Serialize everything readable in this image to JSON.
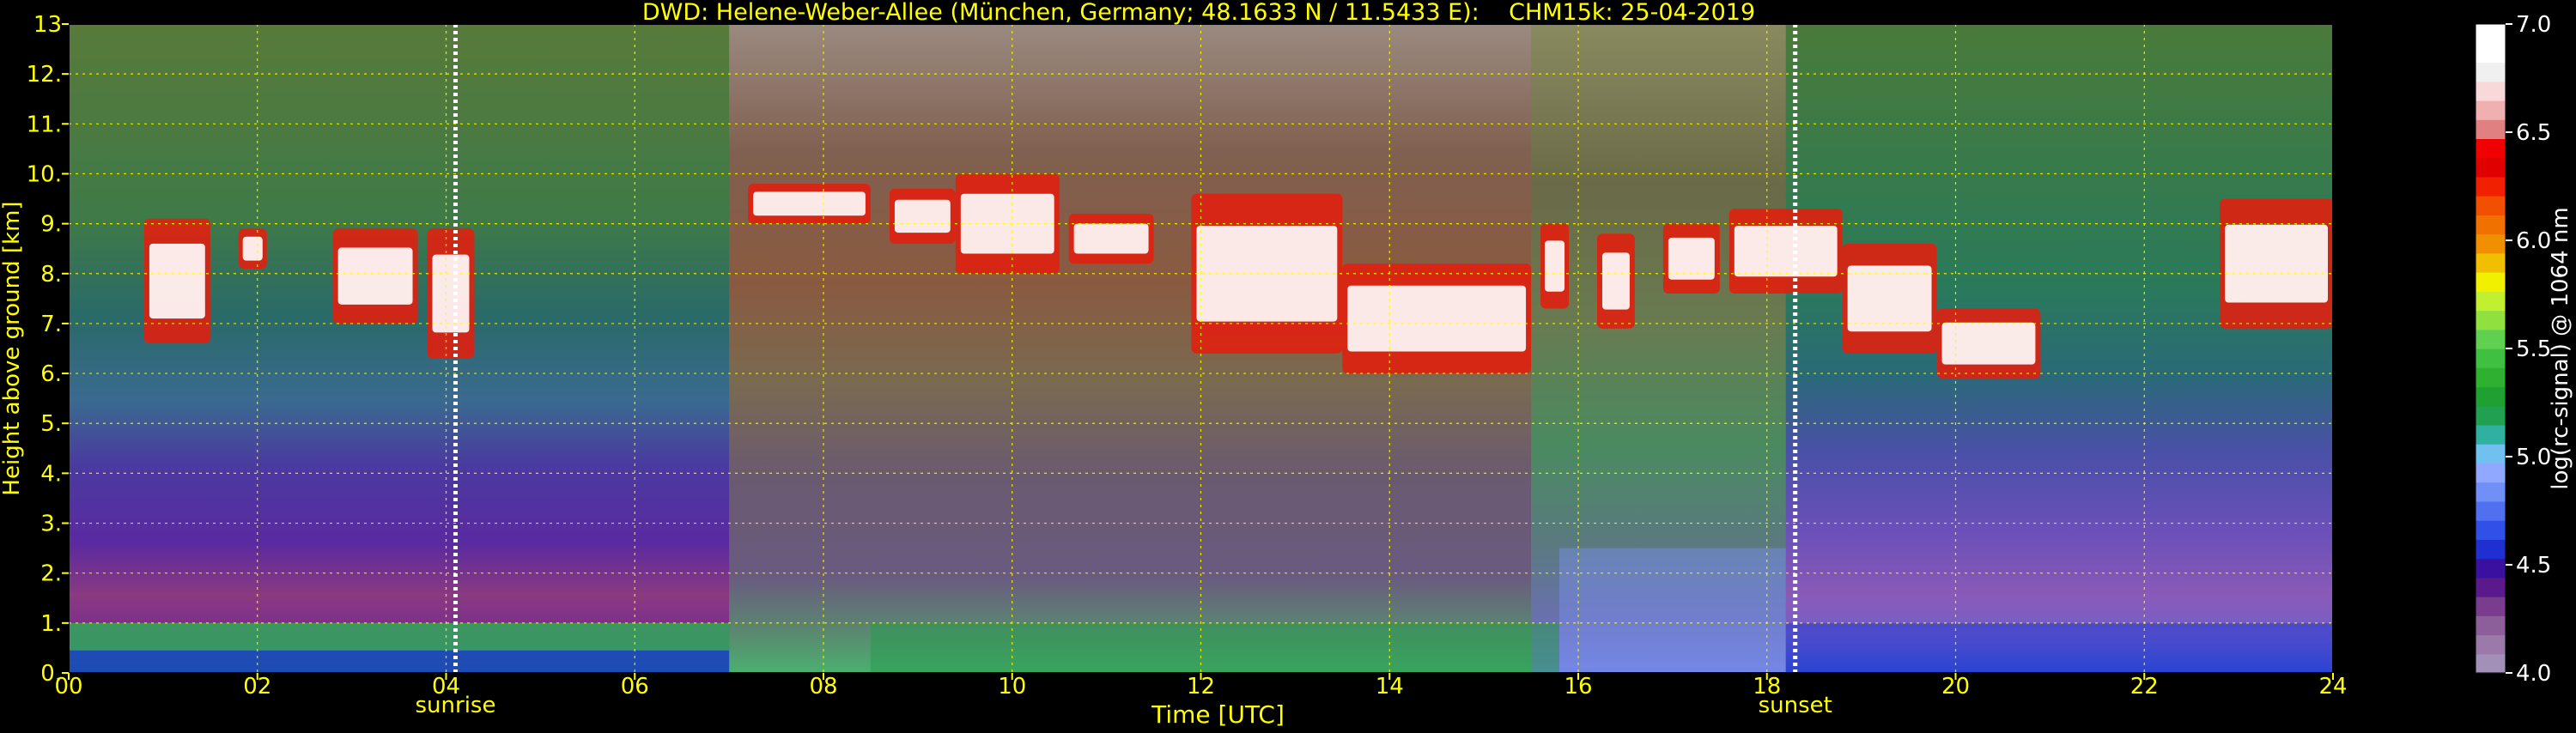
{
  "colors": {
    "background": "#000000",
    "axis_text": "#ffff00",
    "colorbar_text": "#ffffff",
    "grid": "#ffff00",
    "marker_line": "#ffffff"
  },
  "chart_data": {
    "type": "heatmap",
    "title": "DWD: Helene-Weber-Allee (München, Germany; 48.1633 N / 11.5433 E):    CHM15k: 25-04-2019",
    "xlabel": "Time [UTC]",
    "ylabel": "Height above ground [km]",
    "xlim": [
      0,
      24
    ],
    "ylim": [
      0,
      13
    ],
    "x_ticks": [
      0,
      2,
      4,
      6,
      8,
      10,
      12,
      14,
      16,
      18,
      20,
      22,
      24
    ],
    "x_tick_labels": [
      "00",
      "02",
      "04",
      "06",
      "08",
      "10",
      "12",
      "14",
      "16",
      "18",
      "20",
      "22",
      "24"
    ],
    "y_ticks": [
      0,
      1,
      2,
      3,
      4,
      5,
      6,
      7,
      8,
      9,
      10,
      11,
      12,
      13
    ],
    "y_tick_labels": [
      "0.",
      "1.",
      "2.",
      "3.",
      "4.",
      "5.",
      "6.",
      "7.",
      "8.",
      "9.",
      "10.",
      "11.",
      "12.",
      "13"
    ],
    "grid": true,
    "markers": [
      {
        "label": "sunrise",
        "time": 4.1
      },
      {
        "label": "sunset",
        "time": 18.3
      }
    ],
    "colorbar": {
      "label": "log(rc-signal) @ 1064 nm",
      "range": [
        4.0,
        7.0
      ],
      "ticks": [
        4.0,
        4.5,
        5.0,
        5.5,
        6.0,
        6.5,
        7.0
      ],
      "tick_labels": [
        "4.0",
        "4.5",
        "5.0",
        "5.5",
        "6.0",
        "6.5",
        "7.0"
      ],
      "colors": [
        "#a390b8",
        "#9b79a8",
        "#8d5f9a",
        "#7a3c8c",
        "#5a1a8c",
        "#3a10a0",
        "#2030d0",
        "#3050e8",
        "#5070f0",
        "#7090f8",
        "#90a8ff",
        "#70c0f0",
        "#30b0a0",
        "#20a050",
        "#20a030",
        "#30b030",
        "#40c040",
        "#60d050",
        "#90e040",
        "#c0f030",
        "#f0f000",
        "#f0c000",
        "#f09000",
        "#f07000",
        "#f05000",
        "#f02000",
        "#e00000",
        "#f00000",
        "#e08080",
        "#f0b0b0",
        "#f8d8d8",
        "#f0f0f0",
        "#ffffff",
        "#ffffff"
      ]
    },
    "cloud_layers": [
      {
        "start": 0.8,
        "end": 1.5,
        "base": 6.6,
        "top": 9.1
      },
      {
        "start": 1.8,
        "end": 2.1,
        "base": 8.1,
        "top": 8.9
      },
      {
        "start": 2.8,
        "end": 3.7,
        "base": 7.0,
        "top": 8.9
      },
      {
        "start": 3.8,
        "end": 4.3,
        "base": 6.3,
        "top": 8.9
      },
      {
        "start": 7.2,
        "end": 8.5,
        "base": 9.0,
        "top": 9.8
      },
      {
        "start": 8.7,
        "end": 9.4,
        "base": 8.6,
        "top": 9.7
      },
      {
        "start": 9.4,
        "end": 10.5,
        "base": 8.0,
        "top": 10.0
      },
      {
        "start": 10.6,
        "end": 11.5,
        "base": 8.2,
        "top": 9.2
      },
      {
        "start": 11.9,
        "end": 13.5,
        "base": 6.4,
        "top": 9.6
      },
      {
        "start": 13.5,
        "end": 15.5,
        "base": 6.0,
        "top": 8.2
      },
      {
        "start": 15.6,
        "end": 15.9,
        "base": 7.3,
        "top": 9.0
      },
      {
        "start": 16.2,
        "end": 16.6,
        "base": 6.9,
        "top": 8.8
      },
      {
        "start": 16.9,
        "end": 17.5,
        "base": 7.6,
        "top": 9.0
      },
      {
        "start": 17.6,
        "end": 18.8,
        "base": 7.6,
        "top": 9.3
      },
      {
        "start": 18.8,
        "end": 19.8,
        "base": 6.4,
        "top": 8.6
      },
      {
        "start": 19.8,
        "end": 20.9,
        "base": 5.9,
        "top": 7.3
      },
      {
        "start": 22.8,
        "end": 24.0,
        "base": 6.9,
        "top": 9.5
      }
    ]
  }
}
